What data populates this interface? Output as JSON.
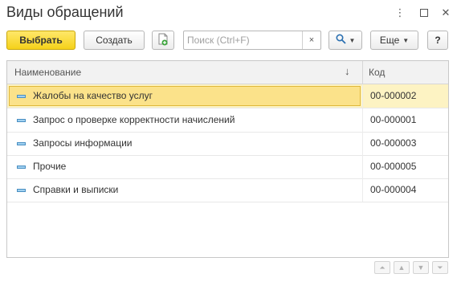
{
  "window": {
    "title": "Виды обращений",
    "controls": [
      "more-icon",
      "maximize-icon",
      "close-icon"
    ]
  },
  "toolbar": {
    "select_label": "Выбрать",
    "create_label": "Создать",
    "copy_icon": "copy-add-icon",
    "search_placeholder": "Поиск (Ctrl+F)",
    "clear_label": "×",
    "search_icon": "magnifier-icon",
    "more_label": "Еще",
    "help_label": "?"
  },
  "table": {
    "columns": [
      "Наименование",
      "Код"
    ],
    "sort_indicator": "↓",
    "rows": [
      {
        "name": "Жалобы на качество услуг",
        "code": "00-000002",
        "selected": true
      },
      {
        "name": "Запрос о проверке корректности начислений",
        "code": "00-000001"
      },
      {
        "name": "Запросы информации",
        "code": "00-000003"
      },
      {
        "name": "Прочие",
        "code": "00-000005"
      },
      {
        "name": "Справки и выписки",
        "code": "00-000004"
      }
    ]
  },
  "colors": {
    "primary_button": "#f5d21a",
    "selected_row": "#fdf3c3",
    "selected_cell": "#fbe28a",
    "item_icon": "#4a8fc2"
  }
}
